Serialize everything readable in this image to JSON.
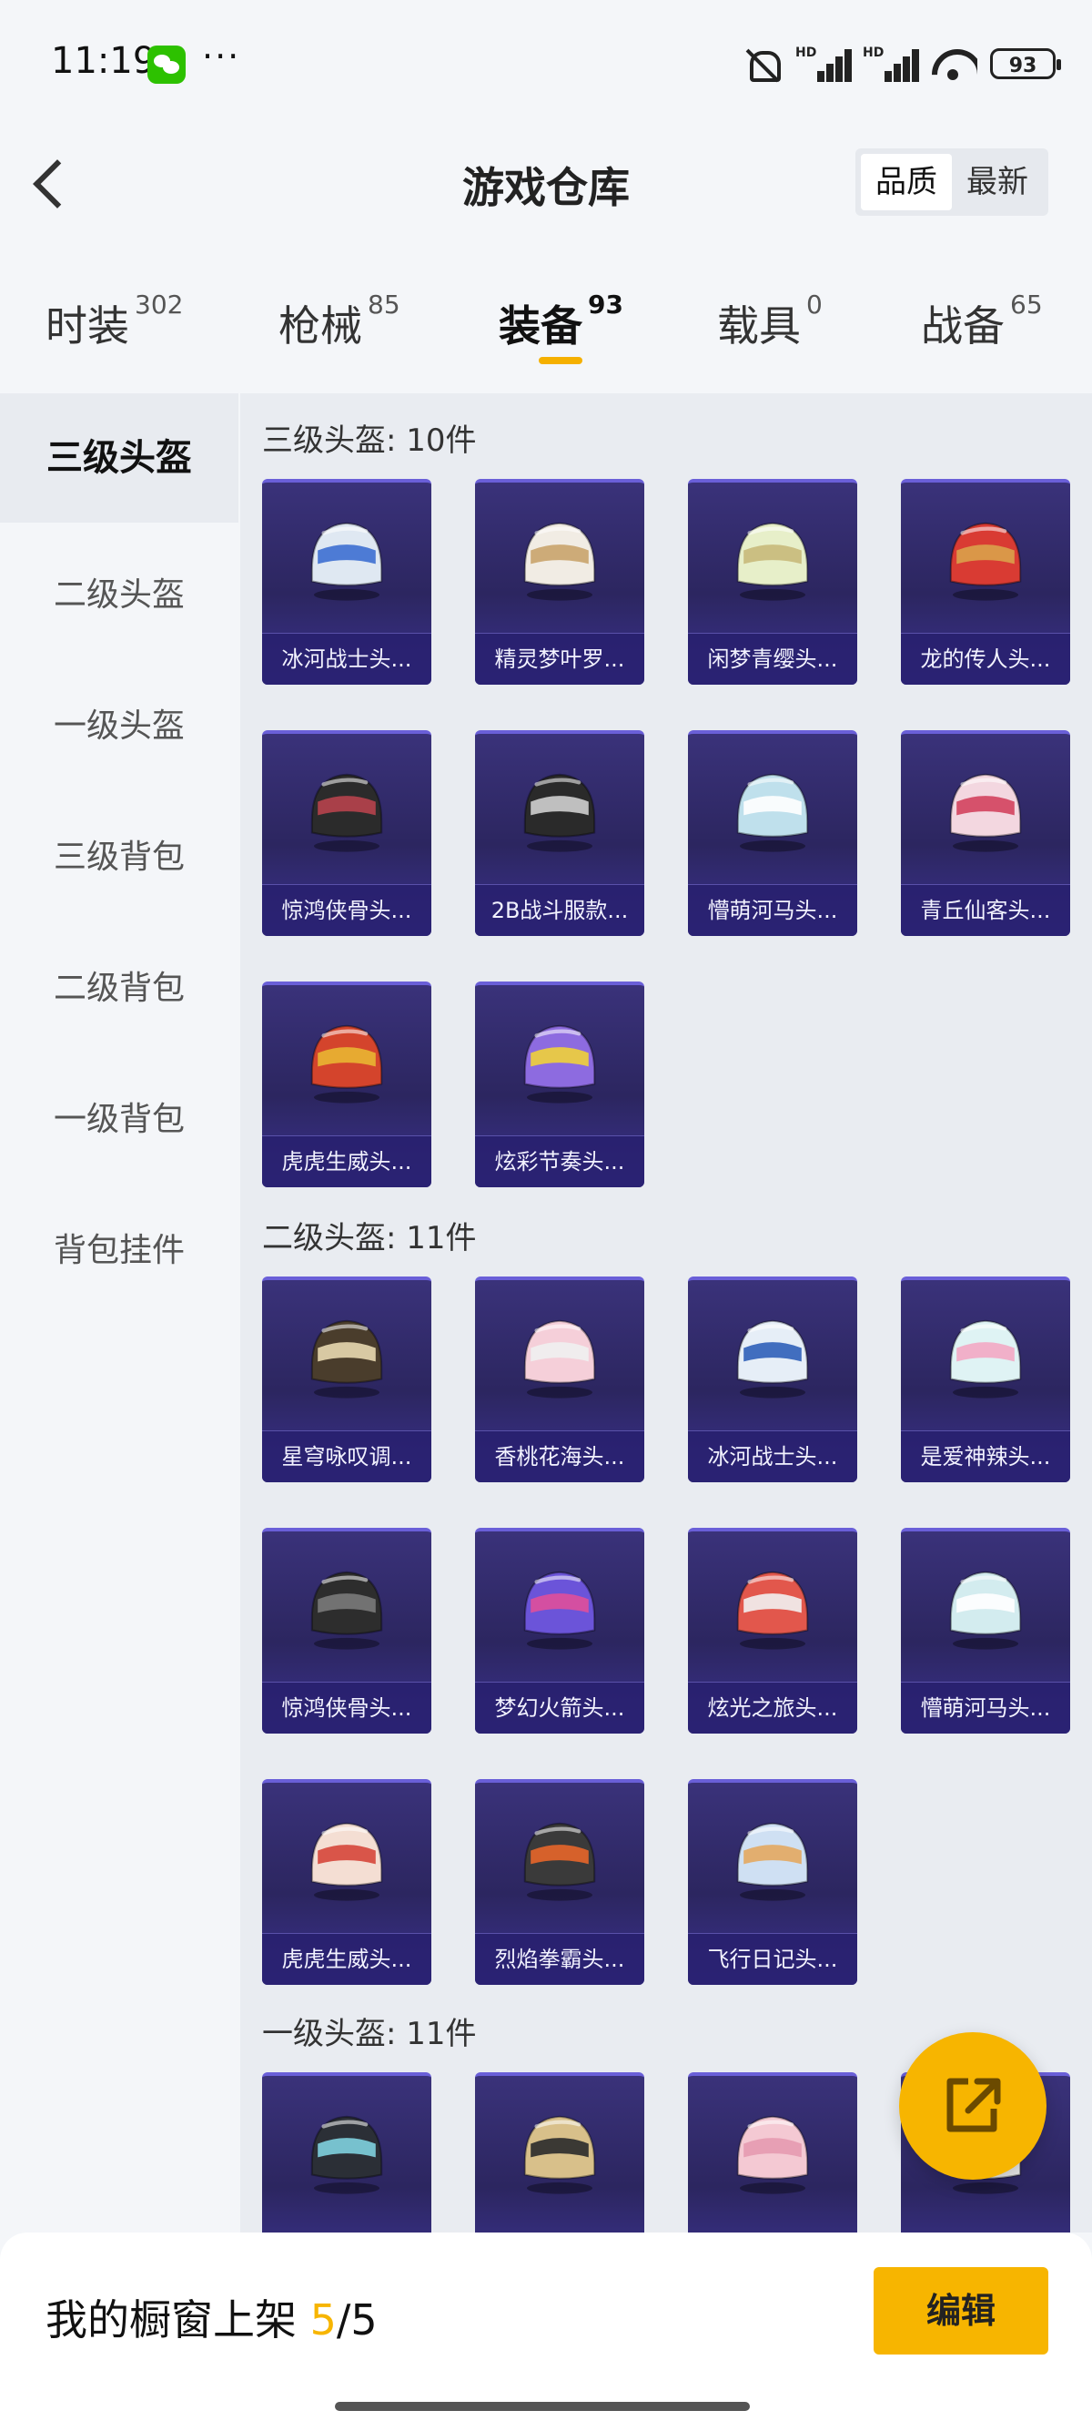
{
  "status_bar": {
    "time": "11:19",
    "battery": "93",
    "more": "···"
  },
  "header": {
    "title": "游戏仓库",
    "sort_options": [
      "品质",
      "最新"
    ],
    "sort_selected": "品质"
  },
  "tabs": [
    {
      "label": "时装",
      "count": "302"
    },
    {
      "label": "枪械",
      "count": "85"
    },
    {
      "label": "装备",
      "count": "93",
      "active": true
    },
    {
      "label": "载具",
      "count": "0"
    },
    {
      "label": "战备",
      "count": "65"
    }
  ],
  "sidebar": {
    "items": [
      "三级头盔",
      "二级头盔",
      "一级头盔",
      "三级背包",
      "二级背包",
      "一级背包",
      "背包挂件"
    ],
    "selected": "三级头盔"
  },
  "sections": [
    {
      "title": "三级头盔: 10件",
      "items": [
        {
          "name": "冰河战士头...",
          "color": "#dfe8f2",
          "accent": "#3d6fd1"
        },
        {
          "name": "精灵梦叶罗...",
          "color": "#f1ece4",
          "accent": "#c9a46b"
        },
        {
          "name": "闲梦青缨头...",
          "color": "#e7efc9",
          "accent": "#c8b97a"
        },
        {
          "name": "龙的传人头...",
          "color": "#d93b33",
          "accent": "#d9a24a"
        },
        {
          "name": "惊鸿侠骨头...",
          "color": "#2b2b2b",
          "accent": "#b7434d"
        },
        {
          "name": "2B战斗服款...",
          "color": "#2a2a2a",
          "accent": "#cfcfcf"
        },
        {
          "name": "懵萌河马头...",
          "color": "#bfe0ec",
          "accent": "#ffffff"
        },
        {
          "name": "青丘仙客头...",
          "color": "#f3d7e0",
          "accent": "#d3425e"
        },
        {
          "name": "虎虎生威头...",
          "color": "#d4442c",
          "accent": "#e9b632"
        },
        {
          "name": "炫彩节奏头...",
          "color": "#8d6be0",
          "accent": "#f0d23a"
        }
      ]
    },
    {
      "title": "二级头盔: 11件",
      "items": [
        {
          "name": "星穹咏叹调...",
          "color": "#4a3d2c",
          "accent": "#e8d8b0"
        },
        {
          "name": "香桃花海头...",
          "color": "#f5cfd9",
          "accent": "#f0f0f0"
        },
        {
          "name": "冰河战士头...",
          "color": "#e6eef7",
          "accent": "#2f5fb8"
        },
        {
          "name": "是爱神辣头...",
          "color": "#dff3f4",
          "accent": "#f3a9c4"
        },
        {
          "name": "惊鸿侠骨头...",
          "color": "#2d2d2d",
          "accent": "#7a7a7a"
        },
        {
          "name": "梦幻火箭头...",
          "color": "#6b54d9",
          "accent": "#e04f9a"
        },
        {
          "name": "炫光之旅头...",
          "color": "#e2574c",
          "accent": "#f2f2f2"
        },
        {
          "name": "懵萌河马头...",
          "color": "#d3ecef",
          "accent": "#ffffff"
        },
        {
          "name": "虎虎生威头...",
          "color": "#f4ded3",
          "accent": "#d6463a"
        },
        {
          "name": "烈焰拳霸头...",
          "color": "#3a3a3a",
          "accent": "#e8662a"
        },
        {
          "name": "飞行日记头...",
          "color": "#cfe0f3",
          "accent": "#e3a860"
        }
      ]
    },
    {
      "title": "一级头盔: 11件",
      "items": [
        {
          "name": "",
          "color": "#2b2f36",
          "accent": "#7fd1df"
        },
        {
          "name": "",
          "color": "#d8c08a",
          "accent": "#2a2a2a"
        },
        {
          "name": "",
          "color": "#f4c9d3",
          "accent": "#e69ab0"
        },
        {
          "name": "",
          "color": "#e8e8e8",
          "accent": "#9acbd6"
        }
      ]
    }
  ],
  "bottom_bar": {
    "label": "我的橱窗上架",
    "count": "5",
    "total": "/5",
    "edit_label": "编辑"
  },
  "colors": {
    "accent": "#f7b500",
    "card_bg": "#2c2660"
  }
}
